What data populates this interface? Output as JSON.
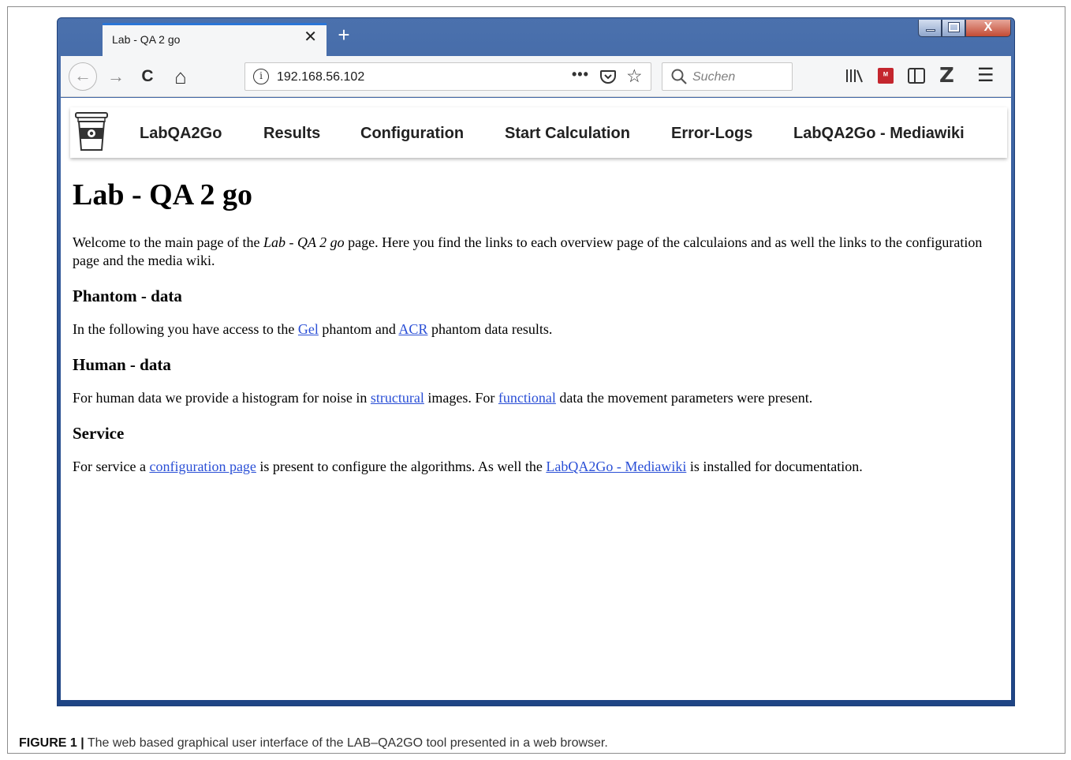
{
  "browser": {
    "tab_title": "Lab - QA 2 go",
    "tab_close": "✕",
    "new_tab": "+",
    "url": "192.168.56.102",
    "url_more": "•••",
    "search_placeholder": "Suchen",
    "ext_label": "ᴹ",
    "zotero_label": "Z",
    "menu_glyph": "☰",
    "back_glyph": "←",
    "forward_glyph": "→",
    "reload_glyph": "C",
    "home_glyph": "⌂",
    "star_glyph": "☆",
    "close_glyph": "X",
    "info_glyph": "i"
  },
  "navbar": {
    "items": [
      "LabQA2Go",
      "Results",
      "Configuration",
      "Start Calculation",
      "Error-Logs",
      "LabQA2Go - Mediawiki"
    ]
  },
  "page": {
    "title": "Lab - QA 2 go",
    "intro": {
      "pre": "Welcome to the main page of the ",
      "em": "Lab - QA 2 go",
      "post": " page. Here you find the links to each overview page of the calculaions and as well the links to the configuration page and the media wiki."
    },
    "phantom": {
      "heading": "Phantom - data",
      "pre": "In the following you have access to the ",
      "link1": "Gel",
      "mid": " phantom and ",
      "link2": "ACR",
      "post": " phantom data results."
    },
    "human": {
      "heading": "Human - data",
      "pre": "For human data we provide a histogram for noise in ",
      "link1": "structural",
      "mid": " images. For ",
      "link2": "functional",
      "post": " data the movement parameters were present."
    },
    "service": {
      "heading": "Service",
      "pre": "For service a ",
      "link1": "configuration page",
      "mid": " is present to configure the algorithms. As well the ",
      "link2": "LabQA2Go - Mediawiki",
      "post": " is installed for documentation."
    }
  },
  "caption": {
    "label": "FIGURE 1 |",
    "text": " The web based graphical user interface of the LAB–QA2GO tool presented in a web browser."
  },
  "colors": {
    "link": "#2a4fd6",
    "window_frame": "#2e5597",
    "tab_accent": "#2a75d6"
  }
}
